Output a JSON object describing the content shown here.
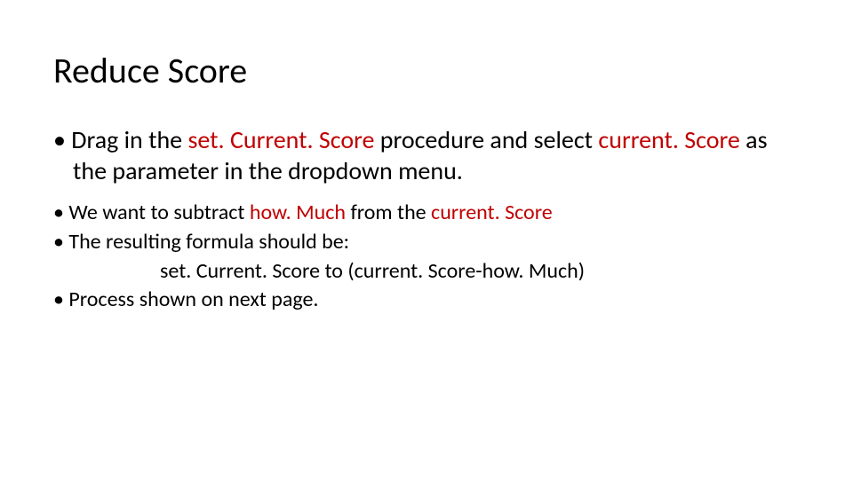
{
  "title": "Reduce Score",
  "b1": {
    "pre": "• Drag in the ",
    "proc": "set. Current. Score",
    "mid": " procedure and select ",
    "param": "current. Score",
    "post": " as the parameter in the dropdown menu."
  },
  "b2": {
    "pre": "• We want to subtract ",
    "hm": "how. Much",
    "mid": " from the ",
    "cs": "current. Score"
  },
  "b3": "• The resulting formula should be:",
  "b3f": "set. Current. Score to (current. Score-how. Much)",
  "b4": "• Process shown on next page."
}
